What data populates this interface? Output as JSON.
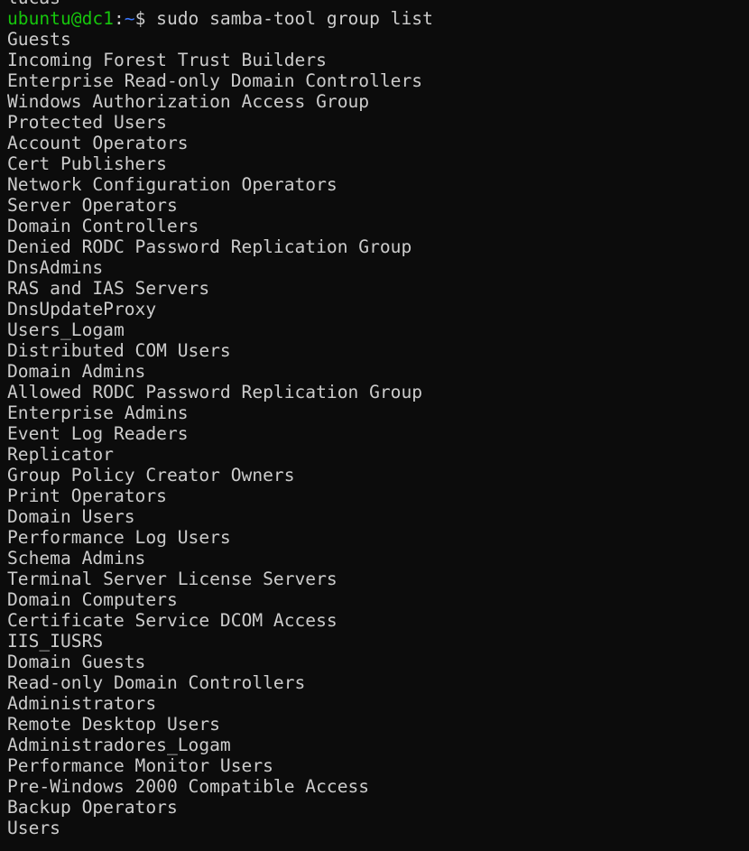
{
  "terminal": {
    "colors": {
      "background": "#0c0c0c",
      "foreground": "#cccccc",
      "prompt_user": "#16c60c",
      "prompt_path": "#3b78ff"
    },
    "previous_line": "lucas",
    "prompt": {
      "user_host": "ubuntu@dc1",
      "separator": ":",
      "path": "~",
      "symbol": "$ ",
      "command": "sudo samba-tool group list"
    },
    "output": [
      "Guests",
      "Incoming Forest Trust Builders",
      "Enterprise Read-only Domain Controllers",
      "Windows Authorization Access Group",
      "Protected Users",
      "Account Operators",
      "Cert Publishers",
      "Network Configuration Operators",
      "Server Operators",
      "Domain Controllers",
      "Denied RODC Password Replication Group",
      "DnsAdmins",
      "RAS and IAS Servers",
      "DnsUpdateProxy",
      "Users_Logam",
      "Distributed COM Users",
      "Domain Admins",
      "Allowed RODC Password Replication Group",
      "Enterprise Admins",
      "Event Log Readers",
      "Replicator",
      "Group Policy Creator Owners",
      "Print Operators",
      "Domain Users",
      "Performance Log Users",
      "Schema Admins",
      "Terminal Server License Servers",
      "Domain Computers",
      "Certificate Service DCOM Access",
      "IIS_IUSRS",
      "Domain Guests",
      "Read-only Domain Controllers",
      "Administrators",
      "Remote Desktop Users",
      "Administradores_Logam",
      "Performance Monitor Users",
      "Pre-Windows 2000 Compatible Access",
      "Backup Operators",
      "Users"
    ]
  }
}
